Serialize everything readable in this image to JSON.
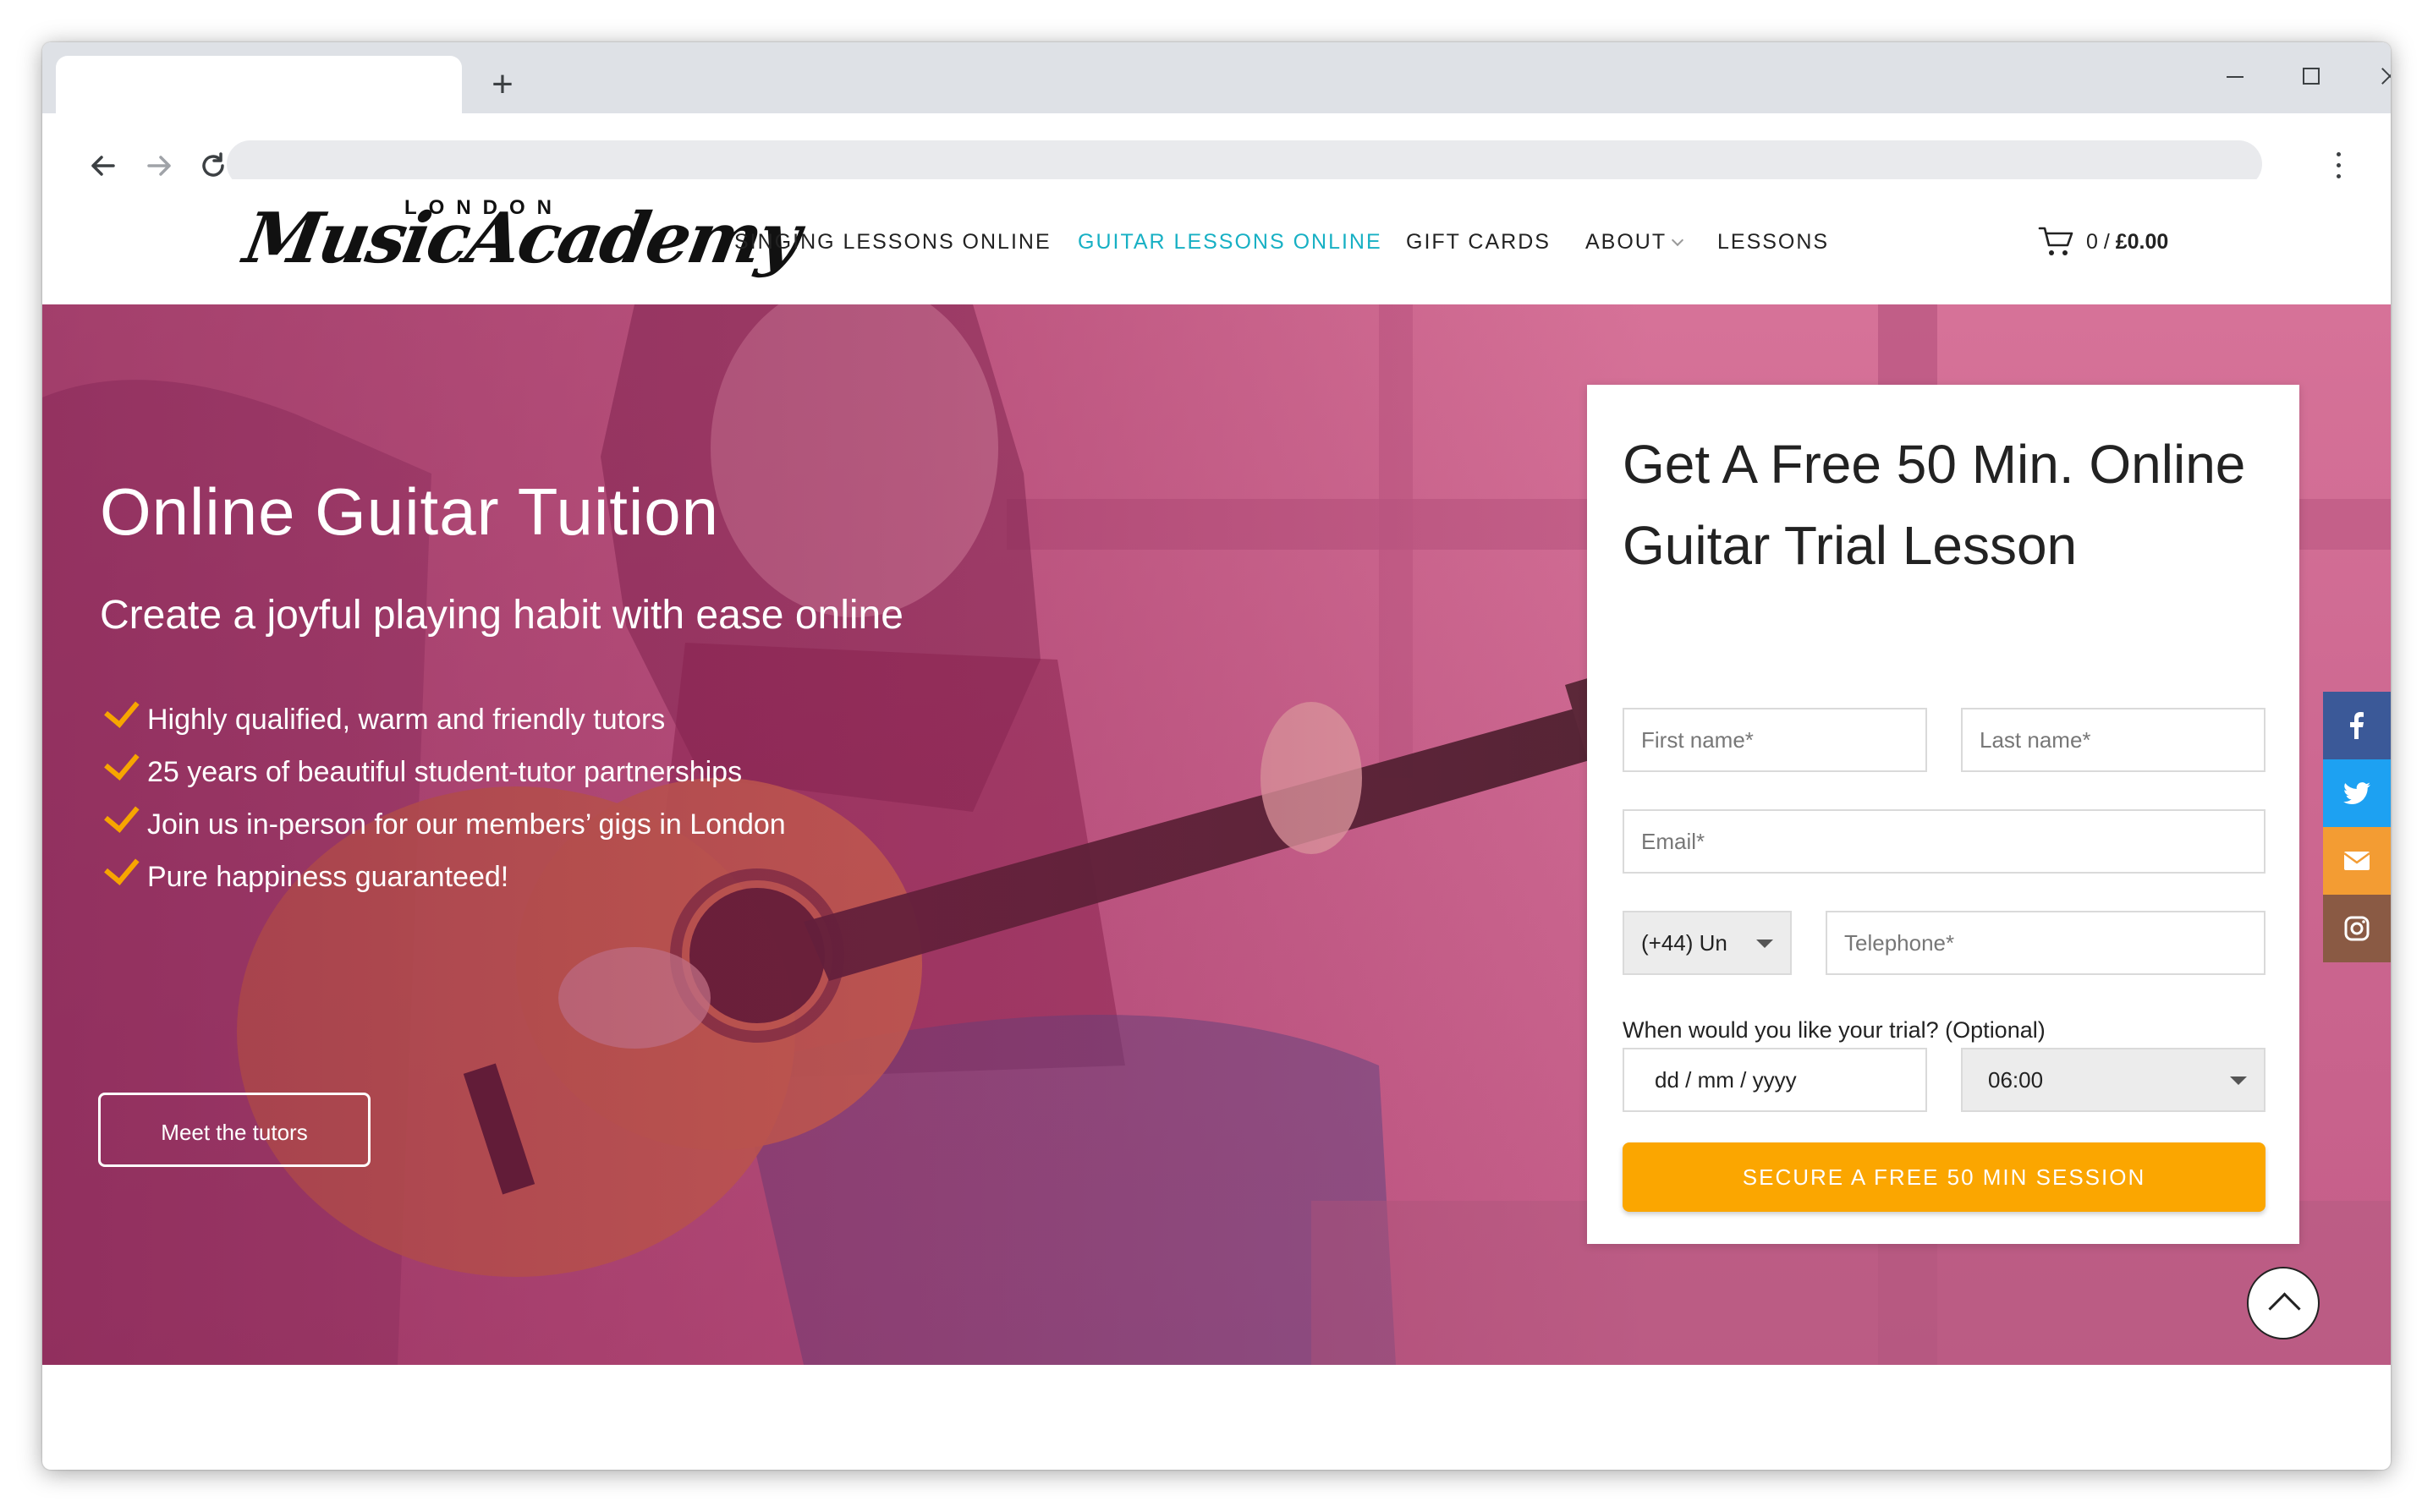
{
  "browser": {
    "new_tab_glyph": "+",
    "address": ""
  },
  "header": {
    "logo_small": "LONDON",
    "logo_script": "MusicAcademy",
    "nav": [
      {
        "label": "SINGING LESSONS ONLINE"
      },
      {
        "label": "GUITAR LESSONS ONLINE"
      },
      {
        "label": "GIFT CARDS"
      },
      {
        "label": "ABOUT"
      },
      {
        "label": "LESSONS"
      }
    ],
    "cart_count": "0 /",
    "cart_total": "£0.00"
  },
  "hero": {
    "title": "Online Guitar Tuition",
    "subtitle": "Create a joyful playing habit with ease online",
    "bullets": [
      "Highly qualified, warm and friendly tutors",
      "25 years of beautiful student-tutor partnerships",
      "Join us in-person for our members’ gigs in London",
      "Pure happiness guaranteed!"
    ],
    "cta_label": "Meet the tutors"
  },
  "form": {
    "title": "Get A Free 50 Min. Online Guitar Trial Lesson",
    "first_name_placeholder": "First name*",
    "last_name_placeholder": "Last name*",
    "email_placeholder": "Email*",
    "country_code_value": "(+44) Un",
    "telephone_placeholder": "Telephone*",
    "when_label": "When would you like your trial? (Optional)",
    "date_value": "dd / mm / yyyy",
    "time_value": "06:00",
    "submit_label": "SECURE A FREE 50 MIN SESSION"
  },
  "social": [
    {
      "icon": "facebook-icon",
      "color": "#3b5998"
    },
    {
      "icon": "twitter-icon",
      "color": "#1da1f2"
    },
    {
      "icon": "email-icon",
      "color": "#f39c33"
    },
    {
      "icon": "instagram-icon",
      "color": "#8a5a44"
    }
  ],
  "colors": {
    "accent_teal": "#17b0c4",
    "accent_orange": "#fba600",
    "hero_tint": "#cd6891"
  }
}
